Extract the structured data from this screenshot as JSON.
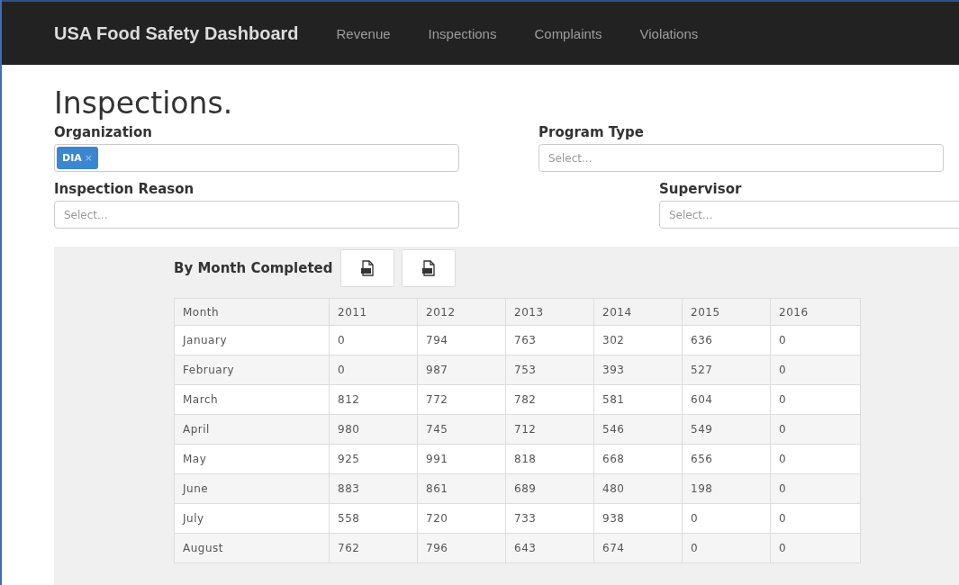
{
  "navbar": {
    "brand": "USA Food Safety Dashboard",
    "links": [
      {
        "label": "Revenue",
        "selected": false
      },
      {
        "label": "Inspections",
        "selected": false
      },
      {
        "label": "Complaints",
        "selected": false
      },
      {
        "label": "Violations",
        "selected": false
      }
    ]
  },
  "page_title": "Inspections.",
  "filters": [
    {
      "label": "Organization",
      "tags": [
        {
          "label": "DIA",
          "remove": "×"
        }
      ]
    },
    {
      "label": "Program Type",
      "placeholder": "Select..."
    },
    {
      "label": "Inspection Reason",
      "placeholder": "Select..."
    },
    {
      "label": "Supervisor",
      "placeholder": "Select..."
    }
  ],
  "panel": {
    "title": "By Month Completed",
    "table": {
      "columns": [
        "Month",
        "2011",
        "2012",
        "2013",
        "2014",
        "2015",
        "2016"
      ],
      "rows": [
        [
          "January",
          "0",
          "794",
          "763",
          "302",
          "636",
          "0"
        ],
        [
          "February",
          "0",
          "987",
          "753",
          "393",
          "527",
          "0"
        ],
        [
          "March",
          "812",
          "772",
          "782",
          "581",
          "604",
          "0"
        ],
        [
          "April",
          "980",
          "745",
          "712",
          "546",
          "549",
          "0"
        ],
        [
          "May",
          "925",
          "991",
          "818",
          "668",
          "656",
          "0"
        ],
        [
          "June",
          "883",
          "861",
          "689",
          "480",
          "198",
          "0"
        ],
        [
          "July",
          "558",
          "720",
          "733",
          "938",
          "0",
          "0"
        ],
        [
          "August",
          "762",
          "796",
          "643",
          "674",
          "0",
          "0"
        ]
      ]
    }
  }
}
